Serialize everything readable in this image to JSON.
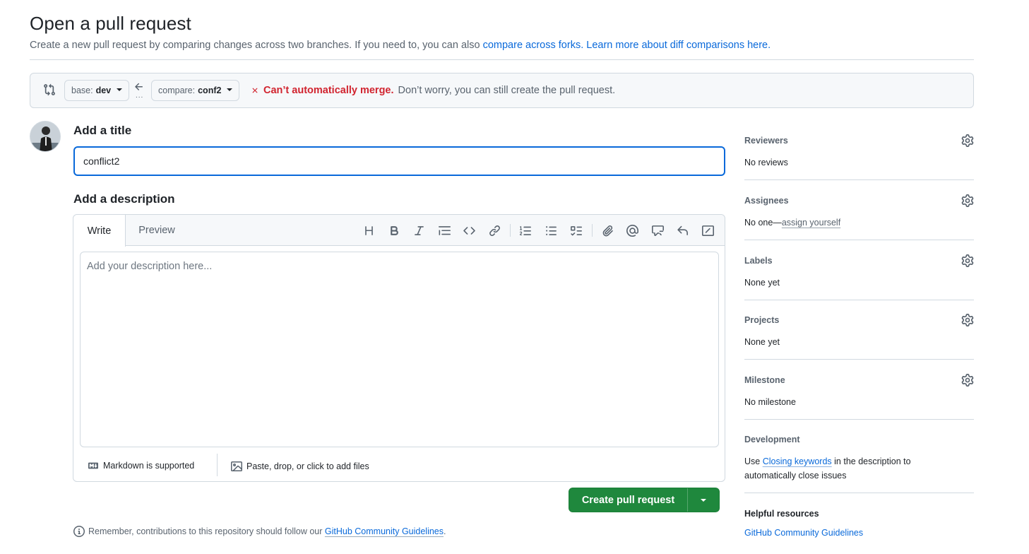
{
  "header": {
    "title": "Open a pull request",
    "subtitle_text": "Create a new pull request by comparing changes across two branches. If you need to, you can also ",
    "compare_forks_link": "compare across forks.",
    "learn_more_link": "Learn more about diff comparisons here."
  },
  "compare": {
    "base_prefix": "base:",
    "base_branch": "dev",
    "compare_prefix": "compare:",
    "compare_branch": "conf2",
    "dots": "...",
    "merge_error": "Can’t automatically merge.",
    "merge_hint": "Don’t worry, you can still create the pull request."
  },
  "form": {
    "title_label": "Add a title",
    "title_value": "conflict2",
    "description_label": "Add a description",
    "tabs": {
      "write": "Write",
      "preview": "Preview"
    },
    "description_placeholder": "Add your description here...",
    "markdown_note": "Markdown is supported",
    "attach_note": "Paste, drop, or click to add files",
    "create_button": "Create pull request",
    "remember_text": "Remember, contributions to this repository should follow our ",
    "guidelines_link": "GitHub Community Guidelines",
    "remember_end": "."
  },
  "toolbar_icons": [
    "heading-icon",
    "bold-icon",
    "italic-icon",
    "quote-icon",
    "code-icon",
    "link-icon",
    "ordered-list-icon",
    "unordered-list-icon",
    "task-list-icon",
    "attach-icon",
    "mention-icon",
    "reference-icon",
    "undo-icon",
    "slash-command-icon"
  ],
  "sidebar": {
    "reviewers": {
      "label": "Reviewers",
      "value": "No reviews"
    },
    "assignees": {
      "label": "Assignees",
      "value_prefix": "No one—",
      "assign_link": "assign yourself"
    },
    "labels": {
      "label": "Labels",
      "value": "None yet"
    },
    "projects": {
      "label": "Projects",
      "value": "None yet"
    },
    "milestone": {
      "label": "Milestone",
      "value": "No milestone"
    },
    "development": {
      "label": "Development",
      "text_prefix": "Use ",
      "closing_link": "Closing keywords",
      "text_suffix": " in the description to automatically close issues"
    },
    "helpful": {
      "label": "Helpful resources",
      "link": "GitHub Community Guidelines"
    }
  },
  "colors": {
    "accent": "#0969da",
    "danger": "#d1242f",
    "primary_button": "#1f883d",
    "border": "#d1d9e0"
  }
}
